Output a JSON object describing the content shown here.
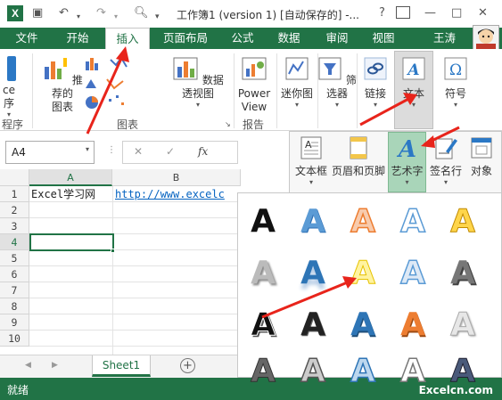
{
  "titlebar": {
    "title": "工作簿1 (version 1) [自动保存的] -...",
    "app_logo": "X",
    "help": "?",
    "minimize": "—",
    "restore": "□",
    "close": "✕"
  },
  "tabs": [
    "文件",
    "开始",
    "插入",
    "页面布局",
    "公式",
    "数据",
    "审阅",
    "视图"
  ],
  "user": "王涛",
  "ribbon": {
    "partial_labels": [
      "ce",
      "序"
    ],
    "recommended_tables": [
      "推荐的",
      "图表"
    ],
    "pivot_chart": "数据透视图",
    "power_view": [
      "Power",
      "View"
    ],
    "sparkline": "迷你图",
    "filter": "筛选器",
    "link": "链接",
    "text": "文本",
    "symbol": "符号",
    "groups": {
      "program": "程序",
      "charts": "图表",
      "report": "报告"
    }
  },
  "namebox": {
    "value": "A4"
  },
  "formula_buttons": {
    "cancel": "✕",
    "enter": "✓",
    "fx": "fx"
  },
  "columns": [
    "A",
    "B"
  ],
  "rows": [
    "1",
    "2",
    "3",
    "4",
    "5",
    "6",
    "7",
    "8",
    "9",
    "10"
  ],
  "cells": {
    "a1": "Excel学习网",
    "b1": "http://www.excelc"
  },
  "text_dropdown": {
    "textbox": "文本框",
    "header_footer": "页眉和页脚",
    "wordart": "艺术字",
    "signature": "签名行",
    "object": "对象"
  },
  "sheet": {
    "tab": "Sheet1",
    "add": "+"
  },
  "status": {
    "ready": "就绪",
    "watermark": "Excelcn.com"
  },
  "colors": {
    "excel_green": "#217346",
    "accent_red": "#e8241b",
    "selected_green": "#a9d5b9"
  }
}
